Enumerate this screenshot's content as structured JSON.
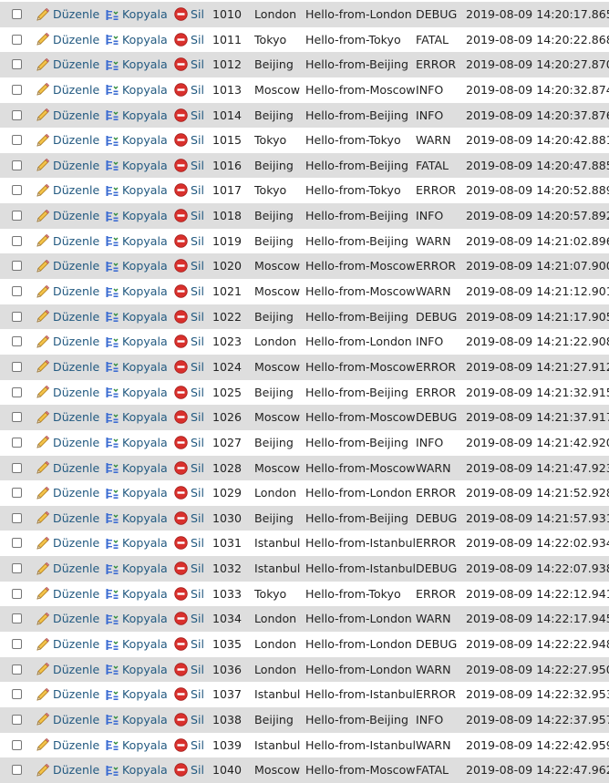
{
  "actions": {
    "edit_label": "Düzenle",
    "copy_label": "Kopyala",
    "delete_label": "Sil",
    "edit_icon": "pencil-icon",
    "copy_icon": "copy-icon",
    "delete_icon": "delete-icon"
  },
  "colors": {
    "link": "#235a81",
    "row_odd": "#dedede",
    "row_even": "#ffffff",
    "delete_icon": "#d9302c"
  },
  "rows": [
    {
      "id": "1010",
      "city": "London",
      "message": "Hello-from-London",
      "level": "DEBUG",
      "timestamp": "2019-08-09 14:20:17.865"
    },
    {
      "id": "1011",
      "city": "Tokyo",
      "message": "Hello-from-Tokyo",
      "level": "FATAL",
      "timestamp": "2019-08-09 14:20:22.868"
    },
    {
      "id": "1012",
      "city": "Beijing",
      "message": "Hello-from-Beijing",
      "level": "ERROR",
      "timestamp": "2019-08-09 14:20:27.870"
    },
    {
      "id": "1013",
      "city": "Moscow",
      "message": "Hello-from-Moscow",
      "level": "INFO",
      "timestamp": "2019-08-09 14:20:32.874"
    },
    {
      "id": "1014",
      "city": "Beijing",
      "message": "Hello-from-Beijing",
      "level": "INFO",
      "timestamp": "2019-08-09 14:20:37.876"
    },
    {
      "id": "1015",
      "city": "Tokyo",
      "message": "Hello-from-Tokyo",
      "level": "WARN",
      "timestamp": "2019-08-09 14:20:42.881"
    },
    {
      "id": "1016",
      "city": "Beijing",
      "message": "Hello-from-Beijing",
      "level": "FATAL",
      "timestamp": "2019-08-09 14:20:47.885"
    },
    {
      "id": "1017",
      "city": "Tokyo",
      "message": "Hello-from-Tokyo",
      "level": "ERROR",
      "timestamp": "2019-08-09 14:20:52.889"
    },
    {
      "id": "1018",
      "city": "Beijing",
      "message": "Hello-from-Beijing",
      "level": "INFO",
      "timestamp": "2019-08-09 14:20:57.892"
    },
    {
      "id": "1019",
      "city": "Beijing",
      "message": "Hello-from-Beijing",
      "level": "WARN",
      "timestamp": "2019-08-09 14:21:02.896"
    },
    {
      "id": "1020",
      "city": "Moscow",
      "message": "Hello-from-Moscow",
      "level": "ERROR",
      "timestamp": "2019-08-09 14:21:07.900"
    },
    {
      "id": "1021",
      "city": "Moscow",
      "message": "Hello-from-Moscow",
      "level": "WARN",
      "timestamp": "2019-08-09 14:21:12.901"
    },
    {
      "id": "1022",
      "city": "Beijing",
      "message": "Hello-from-Beijing",
      "level": "DEBUG",
      "timestamp": "2019-08-09 14:21:17.905"
    },
    {
      "id": "1023",
      "city": "London",
      "message": "Hello-from-London",
      "level": "INFO",
      "timestamp": "2019-08-09 14:21:22.908"
    },
    {
      "id": "1024",
      "city": "Moscow",
      "message": "Hello-from-Moscow",
      "level": "ERROR",
      "timestamp": "2019-08-09 14:21:27.912"
    },
    {
      "id": "1025",
      "city": "Beijing",
      "message": "Hello-from-Beijing",
      "level": "ERROR",
      "timestamp": "2019-08-09 14:21:32.915"
    },
    {
      "id": "1026",
      "city": "Moscow",
      "message": "Hello-from-Moscow",
      "level": "DEBUG",
      "timestamp": "2019-08-09 14:21:37.917"
    },
    {
      "id": "1027",
      "city": "Beijing",
      "message": "Hello-from-Beijing",
      "level": "INFO",
      "timestamp": "2019-08-09 14:21:42.920"
    },
    {
      "id": "1028",
      "city": "Moscow",
      "message": "Hello-from-Moscow",
      "level": "WARN",
      "timestamp": "2019-08-09 14:21:47.923"
    },
    {
      "id": "1029",
      "city": "London",
      "message": "Hello-from-London",
      "level": "ERROR",
      "timestamp": "2019-08-09 14:21:52.928"
    },
    {
      "id": "1030",
      "city": "Beijing",
      "message": "Hello-from-Beijing",
      "level": "DEBUG",
      "timestamp": "2019-08-09 14:21:57.931"
    },
    {
      "id": "1031",
      "city": "Istanbul",
      "message": "Hello-from-Istanbul",
      "level": "ERROR",
      "timestamp": "2019-08-09 14:22:02.934"
    },
    {
      "id": "1032",
      "city": "Istanbul",
      "message": "Hello-from-Istanbul",
      "level": "DEBUG",
      "timestamp": "2019-08-09 14:22:07.938"
    },
    {
      "id": "1033",
      "city": "Tokyo",
      "message": "Hello-from-Tokyo",
      "level": "ERROR",
      "timestamp": "2019-08-09 14:22:12.941"
    },
    {
      "id": "1034",
      "city": "London",
      "message": "Hello-from-London",
      "level": "WARN",
      "timestamp": "2019-08-09 14:22:17.945"
    },
    {
      "id": "1035",
      "city": "London",
      "message": "Hello-from-London",
      "level": "DEBUG",
      "timestamp": "2019-08-09 14:22:22.948"
    },
    {
      "id": "1036",
      "city": "London",
      "message": "Hello-from-London",
      "level": "WARN",
      "timestamp": "2019-08-09 14:22:27.950"
    },
    {
      "id": "1037",
      "city": "Istanbul",
      "message": "Hello-from-Istanbul",
      "level": "ERROR",
      "timestamp": "2019-08-09 14:22:32.953"
    },
    {
      "id": "1038",
      "city": "Beijing",
      "message": "Hello-from-Beijing",
      "level": "INFO",
      "timestamp": "2019-08-09 14:22:37.957"
    },
    {
      "id": "1039",
      "city": "Istanbul",
      "message": "Hello-from-Istanbul",
      "level": "WARN",
      "timestamp": "2019-08-09 14:22:42.959"
    },
    {
      "id": "1040",
      "city": "Moscow",
      "message": "Hello-from-Moscow",
      "level": "FATAL",
      "timestamp": "2019-08-09 14:22:47.962"
    }
  ]
}
